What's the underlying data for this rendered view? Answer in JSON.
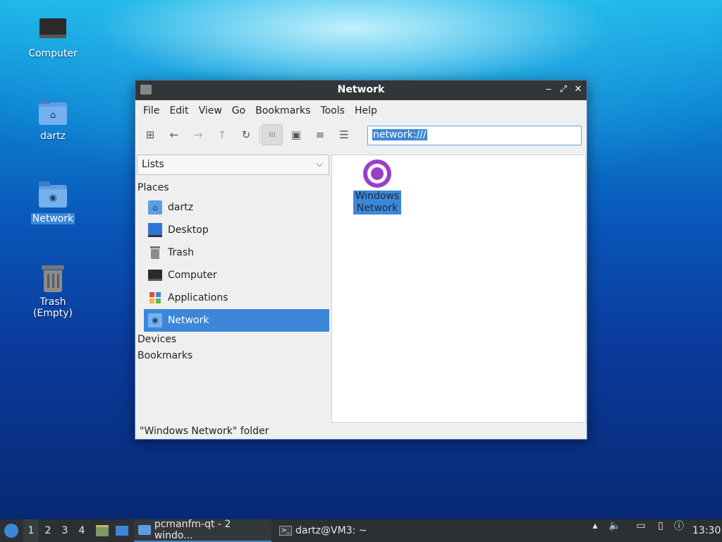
{
  "desktop": {
    "icons": [
      {
        "label": "Computer",
        "icon": "computer-icon"
      },
      {
        "label": "dartz",
        "icon": "home-folder-icon"
      },
      {
        "label": "Network",
        "icon": "network-folder-icon",
        "selected": true
      },
      {
        "label": "Trash (Empty)",
        "icon": "trash-icon"
      }
    ]
  },
  "window": {
    "title": "Network",
    "controls": {
      "minimize": "‒",
      "maximize": "⤢",
      "close": "✕"
    },
    "menu": [
      "File",
      "Edit",
      "View",
      "Go",
      "Bookmarks",
      "Tools",
      "Help"
    ],
    "toolbar": {
      "buttons": [
        {
          "name": "new-tab-icon",
          "glyph": "⊞"
        },
        {
          "name": "back-icon",
          "glyph": "←"
        },
        {
          "name": "forward-icon",
          "glyph": "→"
        },
        {
          "name": "up-icon",
          "glyph": "↑"
        },
        {
          "name": "reload-icon",
          "glyph": "↻"
        },
        {
          "name": "icon-view-icon",
          "glyph": "⁞⁞⁞",
          "active": true
        },
        {
          "name": "thumbnail-view-icon",
          "glyph": "▣"
        },
        {
          "name": "compact-view-icon",
          "glyph": "≡"
        },
        {
          "name": "detailed-list-icon",
          "glyph": "☰"
        }
      ],
      "address": "network:///"
    },
    "sidebar": {
      "mode": "Lists",
      "places_header": "Places",
      "places": [
        {
          "label": "dartz",
          "icon": "home-folder-icon"
        },
        {
          "label": "Desktop",
          "icon": "desktop-icon"
        },
        {
          "label": "Trash",
          "icon": "trash-icon"
        },
        {
          "label": "Computer",
          "icon": "computer-icon"
        },
        {
          "label": "Applications",
          "icon": "applications-icon"
        },
        {
          "label": "Network",
          "icon": "network-icon",
          "selected": true
        }
      ],
      "devices_header": "Devices",
      "bookmarks_header": "Bookmarks"
    },
    "files": [
      {
        "label": "Windows Network",
        "icon": "windows-network-icon",
        "selected": true
      }
    ],
    "status": "\"Windows Network\" folder"
  },
  "taskbar": {
    "workspaces": [
      "1",
      "2",
      "3",
      "4"
    ],
    "active_workspace": "1",
    "tasks": [
      {
        "label": "pcmanfm-qt - 2 windo...",
        "icon": "folder-icon",
        "active": true
      },
      {
        "label": "dartz@VM3: ~",
        "icon": "terminal-icon",
        "active": false
      }
    ],
    "clock": "13:30"
  },
  "colors": {
    "accent": "#3c87d8",
    "titlebar": "#333638",
    "taskbar": "#2d3032",
    "globe": "#9b3fc7"
  }
}
